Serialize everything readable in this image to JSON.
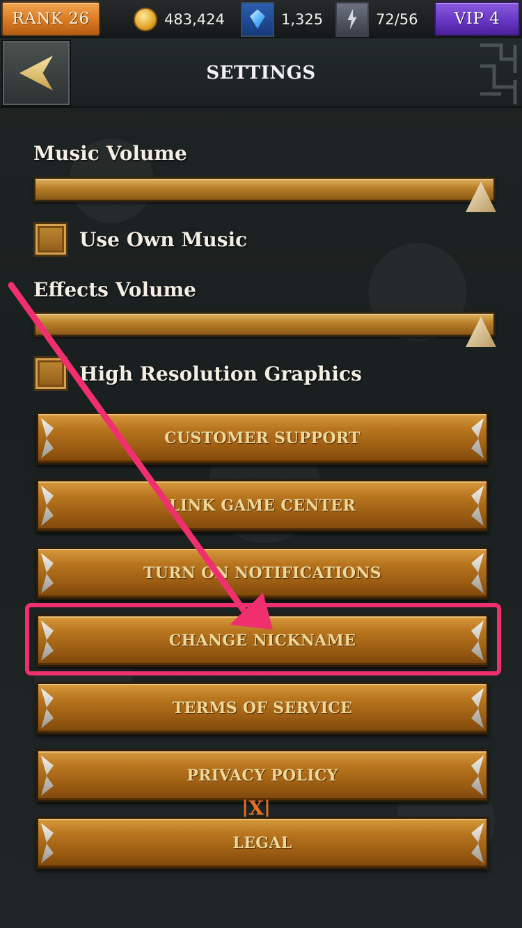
{
  "status_bar": {
    "rank": "RANK 26",
    "coins": "483,424",
    "gems": "1,325",
    "energy": "72/56",
    "vip": "VIP 4",
    "icons": {
      "coins": "gold-coin-icon",
      "gems": "blue-gem-icon",
      "energy": "lightning-icon"
    }
  },
  "header": {
    "title": "SETTINGS",
    "back_icon": "back-arrow-icon"
  },
  "settings": {
    "music_volume_label": "Music Volume",
    "music_volume": 1.0,
    "use_own_music_label": "Use Own Music",
    "use_own_music_checked": false,
    "effects_volume_label": "Effects Volume",
    "effects_volume": 1.0,
    "high_res_label": "High Resolution Graphics",
    "high_res_checked": false
  },
  "menu": [
    {
      "label": "CUSTOMER SUPPORT"
    },
    {
      "label": "LINK GAME CENTER"
    },
    {
      "label": "TURN ON NOTIFICATIONS"
    },
    {
      "label": "CHANGE NICKNAME"
    },
    {
      "label": "TERMS OF SERVICE"
    },
    {
      "label": "PRIVACY POLICY"
    },
    {
      "label": "LEGAL"
    }
  ],
  "annotation": {
    "highlight_color": "#f0306e",
    "highlighted_item": "CHANGE NICKNAME"
  },
  "colors": {
    "button_gold": "#b9761f",
    "rank_orange": "#d97a22",
    "vip_purple": "#6434c2"
  }
}
